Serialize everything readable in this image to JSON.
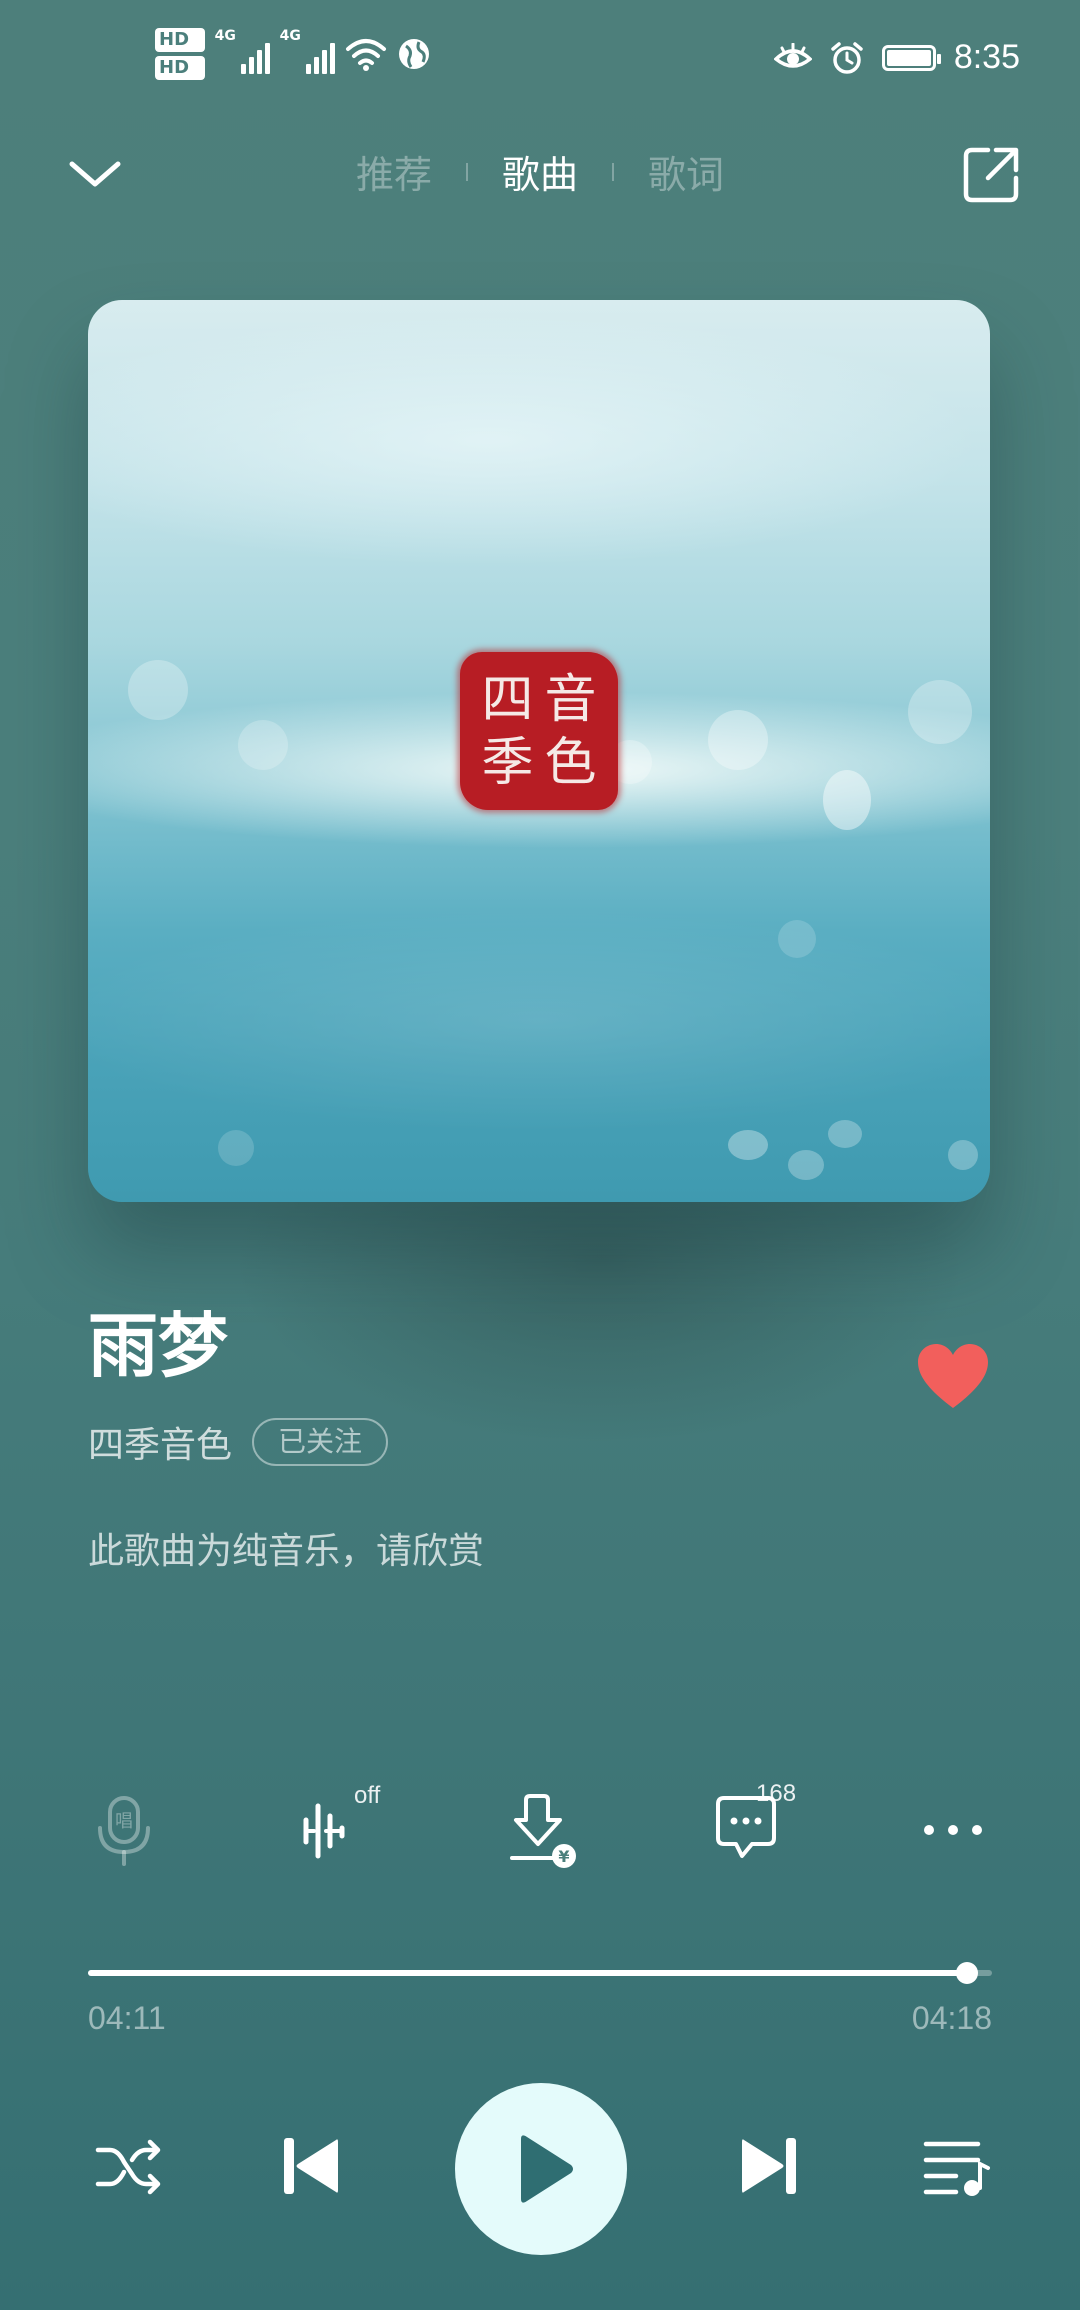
{
  "status_bar": {
    "sim1_label": "HD",
    "sim1_index": "1",
    "sim2_label": "HD",
    "sim2_index": "2",
    "network1": "4G",
    "network2": "4G",
    "time": "8:35"
  },
  "header": {
    "tabs": [
      {
        "label": "推荐",
        "active": false
      },
      {
        "label": "歌曲",
        "active": true
      },
      {
        "label": "歌词",
        "active": false
      }
    ]
  },
  "album": {
    "seal_chars": [
      "四",
      "音",
      "季",
      "色"
    ]
  },
  "song": {
    "title": "雨梦",
    "artist": "四季音色",
    "follow_label": "已关注",
    "notice": "此歌曲为纯音乐，请欣赏",
    "liked": true
  },
  "actions": {
    "sound_effect_badge": "off",
    "comment_count": "168"
  },
  "progress": {
    "current": "04:11",
    "total": "04:18",
    "fraction": 0.972
  },
  "colors": {
    "background": "#4b7f7c",
    "accent_like": "#f25f5c",
    "play_button": "#e4fbfb"
  }
}
